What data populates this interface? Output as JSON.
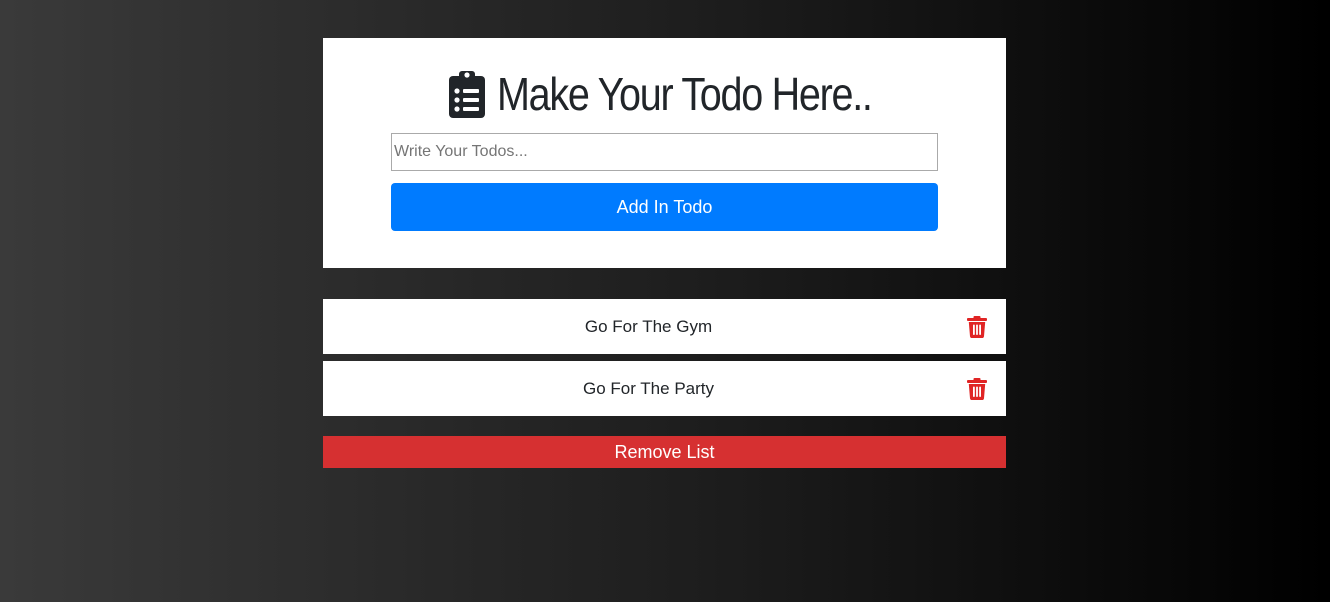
{
  "header": {
    "title": "Make Your Todo Here..",
    "icon": "clipboard-list-icon"
  },
  "form": {
    "input_value": "",
    "input_placeholder": "Write Your Todos...",
    "add_label": "Add In Todo"
  },
  "todos": [
    {
      "text": "Go For The Gym",
      "icon": "trash-icon"
    },
    {
      "text": "Go For The Party",
      "icon": "trash-icon"
    }
  ],
  "actions": {
    "remove_label": "Remove List"
  },
  "colors": {
    "primary": "#007bff",
    "danger": "#d63031",
    "trash": "#e02424",
    "card": "#ffffff"
  }
}
